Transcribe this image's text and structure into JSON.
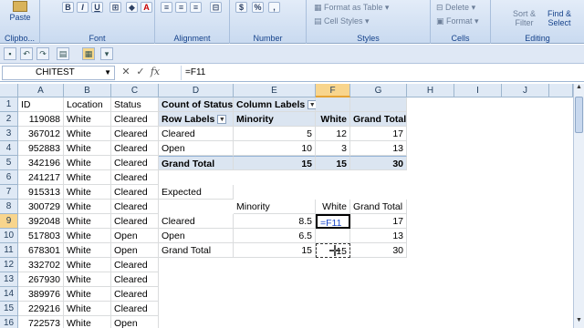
{
  "ribbon": {
    "groups": [
      "Clipbo...",
      "Font",
      "Alignment",
      "Number",
      "Styles",
      "Cells",
      "Editing"
    ],
    "paste_label": "Paste",
    "format_as_table": "Format as Table",
    "cell_styles": "Cell Styles",
    "delete": "Delete",
    "format": "Format",
    "sort_filter": "Sort &\nFilter",
    "find_select": "Find &\nSelect"
  },
  "formula_bar": {
    "name_box": "CHITEST",
    "formula": "=F11"
  },
  "columns": [
    "A",
    "B",
    "C",
    "D",
    "E",
    "F",
    "G",
    "H",
    "I",
    "J"
  ],
  "rows": [
    "1",
    "2",
    "3",
    "4",
    "5",
    "6",
    "7",
    "8",
    "9",
    "10",
    "11",
    "12",
    "13",
    "14",
    "15"
  ],
  "data_rows": [
    {
      "id": "ID",
      "location": "Location",
      "status": "Status"
    },
    {
      "id": "119088",
      "location": "White",
      "status": "Cleared"
    },
    {
      "id": "367012",
      "location": "White",
      "status": "Cleared"
    },
    {
      "id": "952883",
      "location": "White",
      "status": "Cleared"
    },
    {
      "id": "342196",
      "location": "White",
      "status": "Cleared"
    },
    {
      "id": "241217",
      "location": "White",
      "status": "Cleared"
    },
    {
      "id": "915313",
      "location": "White",
      "status": "Cleared"
    },
    {
      "id": "300729",
      "location": "White",
      "status": "Cleared"
    },
    {
      "id": "392048",
      "location": "White",
      "status": "Cleared"
    },
    {
      "id": "517803",
      "location": "White",
      "status": "Open"
    },
    {
      "id": "678301",
      "location": "White",
      "status": "Open"
    },
    {
      "id": "332702",
      "location": "White",
      "status": "Cleared"
    },
    {
      "id": "267930",
      "location": "White",
      "status": "Cleared"
    },
    {
      "id": "389976",
      "location": "White",
      "status": "Cleared"
    },
    {
      "id": "229216",
      "location": "White",
      "status": "Cleared"
    },
    {
      "id": "722573",
      "location": "White",
      "status": "Open"
    }
  ],
  "pivot": {
    "count_of_status": "Count of Status",
    "column_labels": "Column Labels",
    "row_labels": "Row Labels",
    "minority": "Minority",
    "white": "White",
    "grand_total": "Grand Total",
    "rows": [
      {
        "label": "Cleared",
        "minority": "5",
        "white": "12",
        "total": "17"
      },
      {
        "label": "Open",
        "minority": "10",
        "white": "3",
        "total": "13"
      },
      {
        "label": "Grand Total",
        "minority": "15",
        "white": "15",
        "total": "30"
      }
    ]
  },
  "expected": {
    "title": "Expected",
    "minority": "Minority",
    "white": "White",
    "grand_total": "Grand Total",
    "rows": [
      {
        "label": "Cleared",
        "minority": "8.5",
        "white": "=F11",
        "total": "17"
      },
      {
        "label": "Open",
        "minority": "6.5",
        "white": "",
        "total": "13"
      },
      {
        "label": "Grand Total",
        "minority": "15",
        "white": "15",
        "total": "30"
      }
    ]
  }
}
